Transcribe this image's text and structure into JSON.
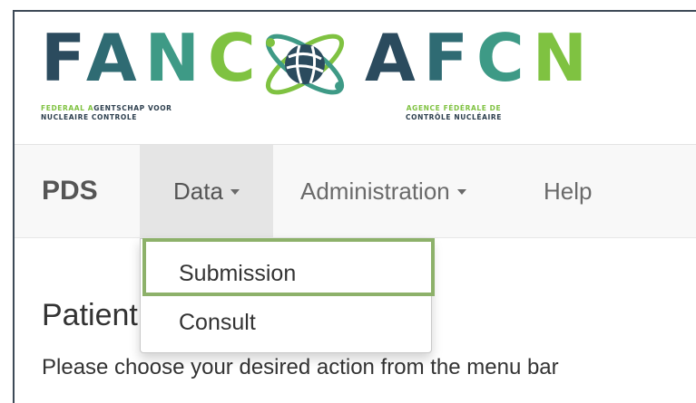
{
  "header": {
    "logo_left": {
      "letters": [
        "F",
        "A",
        "N",
        "C"
      ],
      "colors": [
        "#2b4b5e",
        "#2f6b73",
        "#3e9a86",
        "#7fc241"
      ]
    },
    "logo_right": {
      "letters": [
        "A",
        "F",
        "C",
        "N"
      ],
      "colors": [
        "#2b4b5e",
        "#2f6b73",
        "#3e9a86",
        "#7fc241"
      ]
    },
    "subtitle_nl": {
      "line1_a": "FEDERAAL A",
      "line1_b": "GENTSCHAP VOOR",
      "line2": "NUCLEAIRE CONTROLE"
    },
    "subtitle_fr": {
      "line1": "AGENCE FÉDÉRALE DE",
      "line2": "CONTRÔLE NUCLÉAIRE"
    },
    "emblem_icon": "atom-globe-icon"
  },
  "navbar": {
    "brand": "PDS",
    "items": [
      {
        "label": "Data",
        "has_caret": true,
        "active": true
      },
      {
        "label": "Administration",
        "has_caret": true,
        "active": false
      },
      {
        "label": "Help",
        "has_caret": false,
        "active": false
      }
    ]
  },
  "dropdown": {
    "items": [
      {
        "label": "Submission",
        "highlighted": true
      },
      {
        "label": "Consult",
        "highlighted": false
      }
    ]
  },
  "content": {
    "title": "Patient",
    "instruction": "Please choose your desired action from the menu bar"
  },
  "colors": {
    "highlight_border": "#8db16a",
    "navbar_bg": "#f8f8f8",
    "active_nav_bg": "#e5e5e5",
    "frame_border": "#3d4a57"
  }
}
